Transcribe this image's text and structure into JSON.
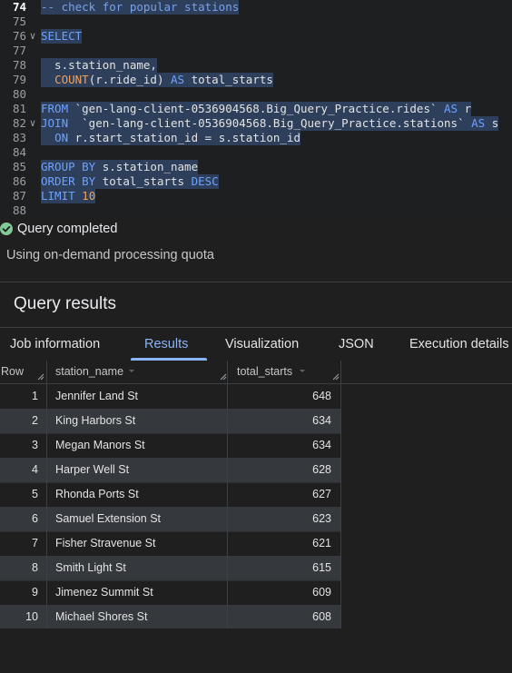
{
  "editor": {
    "lines": [
      {
        "num": "74",
        "current": true,
        "fold": false,
        "selected": true,
        "tokens": [
          {
            "t": "-- check for popular stations",
            "c": "cm"
          }
        ]
      },
      {
        "num": "75",
        "current": false,
        "fold": false,
        "selected": false,
        "tokens": []
      },
      {
        "num": "76",
        "current": false,
        "fold": true,
        "selected": true,
        "tokens": [
          {
            "t": "SELECT",
            "c": "kw"
          }
        ]
      },
      {
        "num": "77",
        "current": false,
        "fold": false,
        "selected": false,
        "tokens": []
      },
      {
        "num": "78",
        "current": false,
        "fold": false,
        "selected": true,
        "tokens": [
          {
            "t": "  s.station_name,",
            "c": "id"
          }
        ]
      },
      {
        "num": "79",
        "current": false,
        "fold": false,
        "selected": true,
        "tokens": [
          {
            "t": "  ",
            "c": "id"
          },
          {
            "t": "COUNT",
            "c": "fn"
          },
          {
            "t": "(r.ride_id) ",
            "c": "id"
          },
          {
            "t": "AS",
            "c": "kw"
          },
          {
            "t": " total_starts",
            "c": "id"
          }
        ]
      },
      {
        "num": "80",
        "current": false,
        "fold": false,
        "selected": false,
        "tokens": []
      },
      {
        "num": "81",
        "current": false,
        "fold": false,
        "selected": true,
        "tokens": [
          {
            "t": "FROM",
            "c": "kw"
          },
          {
            "t": " `gen-lang-client-0536904568.Big_Query_Practice.rides` ",
            "c": "str"
          },
          {
            "t": "AS",
            "c": "kw"
          },
          {
            "t": " r",
            "c": "id"
          }
        ]
      },
      {
        "num": "82",
        "current": false,
        "fold": true,
        "selected": true,
        "tokens": [
          {
            "t": "JOIN",
            "c": "kw"
          },
          {
            "t": "  `gen-lang-client-0536904568.Big_Query_Practice.stations` ",
            "c": "str"
          },
          {
            "t": "AS",
            "c": "kw"
          },
          {
            "t": " s",
            "c": "id"
          }
        ]
      },
      {
        "num": "83",
        "current": false,
        "fold": false,
        "selected": true,
        "tokens": [
          {
            "t": "  ",
            "c": "id"
          },
          {
            "t": "ON",
            "c": "kw"
          },
          {
            "t": " r.start_station_id = s.station_id",
            "c": "id"
          }
        ]
      },
      {
        "num": "84",
        "current": false,
        "fold": false,
        "selected": false,
        "tokens": []
      },
      {
        "num": "85",
        "current": false,
        "fold": false,
        "selected": true,
        "tokens": [
          {
            "t": "GROUP BY",
            "c": "kw"
          },
          {
            "t": " s.station_name",
            "c": "id"
          }
        ]
      },
      {
        "num": "86",
        "current": false,
        "fold": false,
        "selected": true,
        "tokens": [
          {
            "t": "ORDER BY",
            "c": "kw"
          },
          {
            "t": " total_starts ",
            "c": "id"
          },
          {
            "t": "DESC",
            "c": "kw"
          }
        ]
      },
      {
        "num": "87",
        "current": false,
        "fold": false,
        "selected": true,
        "tokens": [
          {
            "t": "LIMIT",
            "c": "kw"
          },
          {
            "t": " ",
            "c": "id"
          },
          {
            "t": "10",
            "c": "num"
          }
        ]
      },
      {
        "num": "88",
        "current": false,
        "fold": false,
        "selected": false,
        "tokens": []
      }
    ]
  },
  "status": {
    "icon": "check-circle-icon",
    "text": "Query completed",
    "quota": "Using on-demand processing quota"
  },
  "results": {
    "title": "Query results",
    "tabs": [
      {
        "label": "Job information",
        "active": false
      },
      {
        "label": "Results",
        "active": true
      },
      {
        "label": "Visualization",
        "active": false
      },
      {
        "label": "JSON",
        "active": false
      },
      {
        "label": "Execution details",
        "active": false
      }
    ],
    "columns": {
      "row": "Row",
      "station_name": "station_name",
      "total_starts": "total_starts"
    },
    "rows": [
      {
        "row": "1",
        "station_name": "Jennifer Land St",
        "total_starts": "648"
      },
      {
        "row": "2",
        "station_name": "King Harbors St",
        "total_starts": "634"
      },
      {
        "row": "3",
        "station_name": "Megan Manors St",
        "total_starts": "634"
      },
      {
        "row": "4",
        "station_name": "Harper Well St",
        "total_starts": "628"
      },
      {
        "row": "5",
        "station_name": "Rhonda Ports St",
        "total_starts": "627"
      },
      {
        "row": "6",
        "station_name": "Samuel Extension St",
        "total_starts": "623"
      },
      {
        "row": "7",
        "station_name": "Fisher Stravenue St",
        "total_starts": "621"
      },
      {
        "row": "8",
        "station_name": "Smith Light St",
        "total_starts": "615"
      },
      {
        "row": "9",
        "station_name": "Jimenez Summit St",
        "total_starts": "609"
      },
      {
        "row": "10",
        "station_name": "Michael Shores St",
        "total_starts": "608"
      }
    ]
  },
  "colors": {
    "accent": "#8ab4f8",
    "success": "#81c995",
    "alt_row": "#35393d"
  }
}
